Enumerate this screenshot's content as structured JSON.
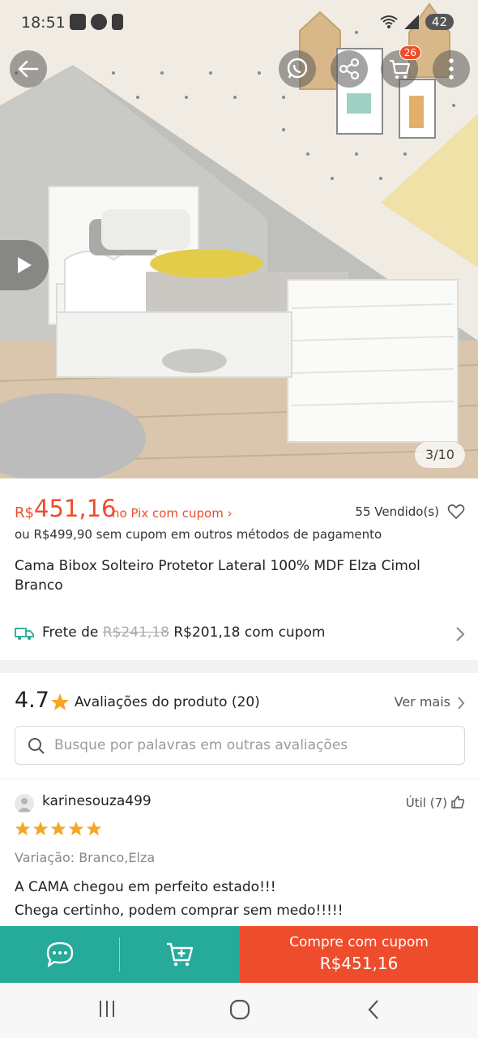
{
  "status_bar": {
    "time": "18:51",
    "battery": "42"
  },
  "hero": {
    "image_description_icon": "bed-product-photo",
    "cart_badge": "26",
    "counter": "3/10"
  },
  "price": {
    "currency": "R$",
    "amount": "451,16",
    "pix_label": "no Pix com cupom ›",
    "sold": "55 Vendido(s)",
    "alt_price": "ou R$499,90 sem cupom em outros métodos de pagamento"
  },
  "product": {
    "title": "Cama Bibox Solteiro Protetor Lateral 100% MDF Elza Cimol Branco"
  },
  "shipping": {
    "label": "Frete de",
    "old_price": "R$241,18",
    "new_price": "R$201,18 com cupom"
  },
  "reviews": {
    "rating": "4.7",
    "label": "Avaliações do produto (20)",
    "see_more": "Ver mais",
    "search_placeholder": "Busque por palavras em outras avaliações",
    "items": [
      {
        "user": "karinesouza499",
        "useful": "Útil (7)",
        "stars": 5,
        "variation": "Variação: Branco,Elza",
        "comment": "A CAMA chegou em perfeito estado!!!\nChega certinho, podem comprar sem medo!!!!!"
      }
    ]
  },
  "actions": {
    "buy_line1": "Compre com cupom",
    "buy_line2": "R$451,16"
  },
  "colors": {
    "accent": "#ee4d2d",
    "teal": "#26aa99",
    "star": "#f5a623"
  }
}
